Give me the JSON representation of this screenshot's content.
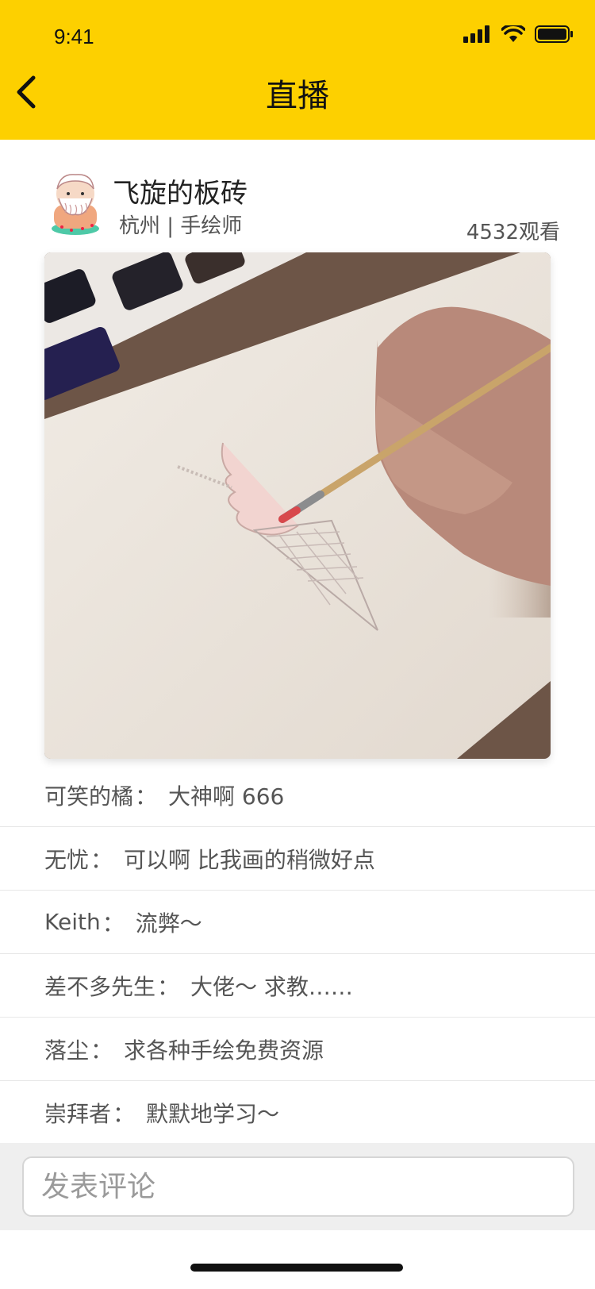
{
  "status_bar": {
    "time": "9:41"
  },
  "header": {
    "title": "直播"
  },
  "host": {
    "name": "飞旋的板砖",
    "meta": "杭州 | 手绘师",
    "viewers": "4532观看"
  },
  "comments": [
    {
      "user": "可笑的橘",
      "text": "大神啊  666"
    },
    {
      "user": "无忧",
      "text": "可以啊 比我画的稍微好点"
    },
    {
      "user": "Keith",
      "text": "流弊～"
    },
    {
      "user": "差不多先生",
      "text": " 大佬～ 求教……"
    },
    {
      "user": "落尘",
      "text": "求各种手绘免费资源"
    },
    {
      "user": "崇拜者",
      "text": "默默地学习～"
    }
  ],
  "comment_separator": "：",
  "input": {
    "placeholder": "发表评论"
  },
  "colors": {
    "header": "#FDD000",
    "input_bar": "#EFEFEF"
  }
}
